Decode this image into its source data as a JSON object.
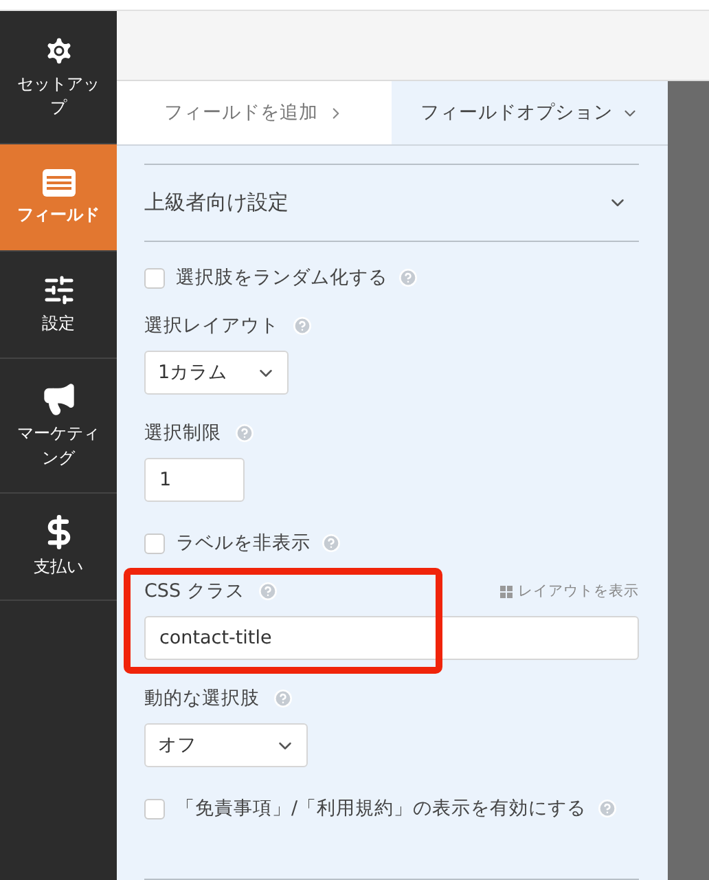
{
  "sidebar": {
    "items": [
      {
        "label": "セットアップ",
        "selected": false
      },
      {
        "label": "フィールド",
        "selected": true
      },
      {
        "label": "設定",
        "selected": false
      },
      {
        "label": "マーケティング",
        "selected": false
      },
      {
        "label": "支払い",
        "selected": false
      }
    ]
  },
  "tabs": [
    {
      "label": "フィールドを追加",
      "selected": false
    },
    {
      "label": "フィールドオプション",
      "selected": true
    }
  ],
  "section": {
    "title": "上級者向け設定",
    "expanded": true
  },
  "options": [
    {
      "kind": "checkbox",
      "label": "選択肢をランダム化する",
      "checked": false
    },
    {
      "kind": "select",
      "label": "選択レイアウト",
      "value": "1カラム"
    },
    {
      "kind": "number",
      "label": "選択制限",
      "value": "1"
    },
    {
      "kind": "checkbox",
      "label": "ラベルを非表示",
      "checked": false
    },
    {
      "kind": "text",
      "label": "CSS クラス",
      "value": "contact-title",
      "link": "レイアウトを表示",
      "highlighted": true
    },
    {
      "kind": "select",
      "label": "動的な選択肢",
      "value": "オフ"
    },
    {
      "kind": "checkbox",
      "label": "「免責事項」/「利用規約」の表示を有効にする",
      "checked": false
    }
  ]
}
